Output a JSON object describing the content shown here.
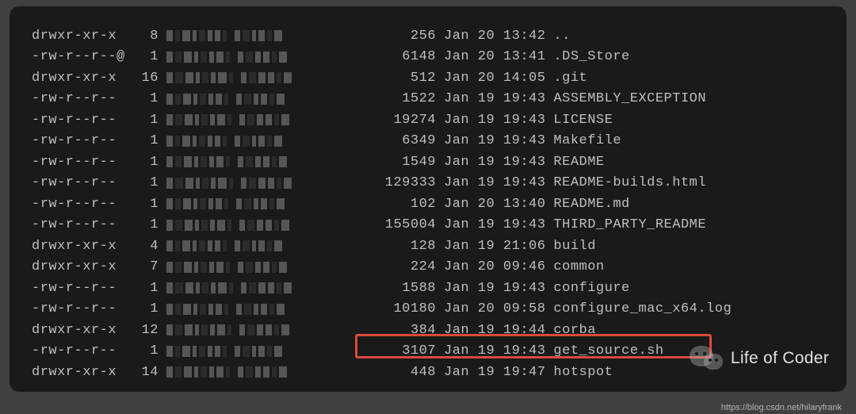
{
  "rows": [
    {
      "perms": "drwxr-xr-x",
      "links": "8",
      "size": "256",
      "date": "Jan 20 13:42",
      "name": ".."
    },
    {
      "perms": "-rw-r--r--@",
      "links": "1",
      "size": "6148",
      "date": "Jan 20 13:41",
      "name": ".DS_Store"
    },
    {
      "perms": "drwxr-xr-x",
      "links": "16",
      "size": "512",
      "date": "Jan 20 14:05",
      "name": ".git"
    },
    {
      "perms": "-rw-r--r--",
      "links": "1",
      "size": "1522",
      "date": "Jan 19 19:43",
      "name": "ASSEMBLY_EXCEPTION"
    },
    {
      "perms": "-rw-r--r--",
      "links": "1",
      "size": "19274",
      "date": "Jan 19 19:43",
      "name": "LICENSE"
    },
    {
      "perms": "-rw-r--r--",
      "links": "1",
      "size": "6349",
      "date": "Jan 19 19:43",
      "name": "Makefile"
    },
    {
      "perms": "-rw-r--r--",
      "links": "1",
      "size": "1549",
      "date": "Jan 19 19:43",
      "name": "README"
    },
    {
      "perms": "-rw-r--r--",
      "links": "1",
      "size": "129333",
      "date": "Jan 19 19:43",
      "name": "README-builds.html"
    },
    {
      "perms": "-rw-r--r--",
      "links": "1",
      "size": "102",
      "date": "Jan 20 13:40",
      "name": "README.md"
    },
    {
      "perms": "-rw-r--r--",
      "links": "1",
      "size": "155004",
      "date": "Jan 19 19:43",
      "name": "THIRD_PARTY_README"
    },
    {
      "perms": "drwxr-xr-x",
      "links": "4",
      "size": "128",
      "date": "Jan 19 21:06",
      "name": "build"
    },
    {
      "perms": "drwxr-xr-x",
      "links": "7",
      "size": "224",
      "date": "Jan 20 09:46",
      "name": "common"
    },
    {
      "perms": "-rw-r--r--",
      "links": "1",
      "size": "1588",
      "date": "Jan 19 19:43",
      "name": "configure"
    },
    {
      "perms": "-rw-r--r--",
      "links": "1",
      "size": "10180",
      "date": "Jan 20 09:58",
      "name": "configure_mac_x64.log"
    },
    {
      "perms": "drwxr-xr-x",
      "links": "12",
      "size": "384",
      "date": "Jan 19 19:44",
      "name": "corba"
    },
    {
      "perms": "-rw-r--r--",
      "links": "1",
      "size": "3107",
      "date": "Jan 19 19:43",
      "name": "get_source.sh"
    },
    {
      "perms": "drwxr-xr-x",
      "links": "14",
      "size": "448",
      "date": "Jan 19 19:47",
      "name": "hotspot"
    }
  ],
  "watermark": {
    "text": "Life of Coder"
  },
  "source": {
    "url": "https://blog.csdn.net/hilaryfrank"
  },
  "highlighted_row_index": 15
}
